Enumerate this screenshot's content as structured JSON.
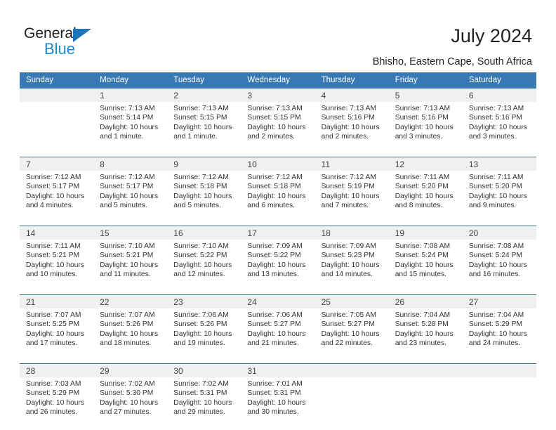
{
  "brand": {
    "name_part1": "General",
    "name_part2": "Blue",
    "color_dark": "#231f20",
    "color_blue": "#2286c9",
    "triangle_color": "#1b75bb"
  },
  "header": {
    "title": "July 2024",
    "subtitle": "Bhisho, Eastern Cape, South Africa"
  },
  "theme": {
    "header_bg": "#3878b4",
    "header_text": "#ffffff",
    "daynum_bg": "#f0f0f0",
    "cell_bg": "#ffffff",
    "separator": "#3878b4"
  },
  "calendar": {
    "weekday_headers": [
      "Sunday",
      "Monday",
      "Tuesday",
      "Wednesday",
      "Thursday",
      "Friday",
      "Saturday"
    ],
    "weeks": [
      {
        "days": [
          {
            "number": "",
            "sunrise": "",
            "sunset": "",
            "daylight_line1": "",
            "daylight_line2": ""
          },
          {
            "number": "1",
            "sunrise": "Sunrise: 7:13 AM",
            "sunset": "Sunset: 5:14 PM",
            "daylight_line1": "Daylight: 10 hours",
            "daylight_line2": "and 1 minute."
          },
          {
            "number": "2",
            "sunrise": "Sunrise: 7:13 AM",
            "sunset": "Sunset: 5:15 PM",
            "daylight_line1": "Daylight: 10 hours",
            "daylight_line2": "and 1 minute."
          },
          {
            "number": "3",
            "sunrise": "Sunrise: 7:13 AM",
            "sunset": "Sunset: 5:15 PM",
            "daylight_line1": "Daylight: 10 hours",
            "daylight_line2": "and 2 minutes."
          },
          {
            "number": "4",
            "sunrise": "Sunrise: 7:13 AM",
            "sunset": "Sunset: 5:16 PM",
            "daylight_line1": "Daylight: 10 hours",
            "daylight_line2": "and 2 minutes."
          },
          {
            "number": "5",
            "sunrise": "Sunrise: 7:13 AM",
            "sunset": "Sunset: 5:16 PM",
            "daylight_line1": "Daylight: 10 hours",
            "daylight_line2": "and 3 minutes."
          },
          {
            "number": "6",
            "sunrise": "Sunrise: 7:13 AM",
            "sunset": "Sunset: 5:16 PM",
            "daylight_line1": "Daylight: 10 hours",
            "daylight_line2": "and 3 minutes."
          }
        ]
      },
      {
        "days": [
          {
            "number": "7",
            "sunrise": "Sunrise: 7:12 AM",
            "sunset": "Sunset: 5:17 PM",
            "daylight_line1": "Daylight: 10 hours",
            "daylight_line2": "and 4 minutes."
          },
          {
            "number": "8",
            "sunrise": "Sunrise: 7:12 AM",
            "sunset": "Sunset: 5:17 PM",
            "daylight_line1": "Daylight: 10 hours",
            "daylight_line2": "and 5 minutes."
          },
          {
            "number": "9",
            "sunrise": "Sunrise: 7:12 AM",
            "sunset": "Sunset: 5:18 PM",
            "daylight_line1": "Daylight: 10 hours",
            "daylight_line2": "and 5 minutes."
          },
          {
            "number": "10",
            "sunrise": "Sunrise: 7:12 AM",
            "sunset": "Sunset: 5:18 PM",
            "daylight_line1": "Daylight: 10 hours",
            "daylight_line2": "and 6 minutes."
          },
          {
            "number": "11",
            "sunrise": "Sunrise: 7:12 AM",
            "sunset": "Sunset: 5:19 PM",
            "daylight_line1": "Daylight: 10 hours",
            "daylight_line2": "and 7 minutes."
          },
          {
            "number": "12",
            "sunrise": "Sunrise: 7:11 AM",
            "sunset": "Sunset: 5:20 PM",
            "daylight_line1": "Daylight: 10 hours",
            "daylight_line2": "and 8 minutes."
          },
          {
            "number": "13",
            "sunrise": "Sunrise: 7:11 AM",
            "sunset": "Sunset: 5:20 PM",
            "daylight_line1": "Daylight: 10 hours",
            "daylight_line2": "and 9 minutes."
          }
        ]
      },
      {
        "days": [
          {
            "number": "14",
            "sunrise": "Sunrise: 7:11 AM",
            "sunset": "Sunset: 5:21 PM",
            "daylight_line1": "Daylight: 10 hours",
            "daylight_line2": "and 10 minutes."
          },
          {
            "number": "15",
            "sunrise": "Sunrise: 7:10 AM",
            "sunset": "Sunset: 5:21 PM",
            "daylight_line1": "Daylight: 10 hours",
            "daylight_line2": "and 11 minutes."
          },
          {
            "number": "16",
            "sunrise": "Sunrise: 7:10 AM",
            "sunset": "Sunset: 5:22 PM",
            "daylight_line1": "Daylight: 10 hours",
            "daylight_line2": "and 12 minutes."
          },
          {
            "number": "17",
            "sunrise": "Sunrise: 7:09 AM",
            "sunset": "Sunset: 5:22 PM",
            "daylight_line1": "Daylight: 10 hours",
            "daylight_line2": "and 13 minutes."
          },
          {
            "number": "18",
            "sunrise": "Sunrise: 7:09 AM",
            "sunset": "Sunset: 5:23 PM",
            "daylight_line1": "Daylight: 10 hours",
            "daylight_line2": "and 14 minutes."
          },
          {
            "number": "19",
            "sunrise": "Sunrise: 7:08 AM",
            "sunset": "Sunset: 5:24 PM",
            "daylight_line1": "Daylight: 10 hours",
            "daylight_line2": "and 15 minutes."
          },
          {
            "number": "20",
            "sunrise": "Sunrise: 7:08 AM",
            "sunset": "Sunset: 5:24 PM",
            "daylight_line1": "Daylight: 10 hours",
            "daylight_line2": "and 16 minutes."
          }
        ]
      },
      {
        "days": [
          {
            "number": "21",
            "sunrise": "Sunrise: 7:07 AM",
            "sunset": "Sunset: 5:25 PM",
            "daylight_line1": "Daylight: 10 hours",
            "daylight_line2": "and 17 minutes."
          },
          {
            "number": "22",
            "sunrise": "Sunrise: 7:07 AM",
            "sunset": "Sunset: 5:26 PM",
            "daylight_line1": "Daylight: 10 hours",
            "daylight_line2": "and 18 minutes."
          },
          {
            "number": "23",
            "sunrise": "Sunrise: 7:06 AM",
            "sunset": "Sunset: 5:26 PM",
            "daylight_line1": "Daylight: 10 hours",
            "daylight_line2": "and 19 minutes."
          },
          {
            "number": "24",
            "sunrise": "Sunrise: 7:06 AM",
            "sunset": "Sunset: 5:27 PM",
            "daylight_line1": "Daylight: 10 hours",
            "daylight_line2": "and 21 minutes."
          },
          {
            "number": "25",
            "sunrise": "Sunrise: 7:05 AM",
            "sunset": "Sunset: 5:27 PM",
            "daylight_line1": "Daylight: 10 hours",
            "daylight_line2": "and 22 minutes."
          },
          {
            "number": "26",
            "sunrise": "Sunrise: 7:04 AM",
            "sunset": "Sunset: 5:28 PM",
            "daylight_line1": "Daylight: 10 hours",
            "daylight_line2": "and 23 minutes."
          },
          {
            "number": "27",
            "sunrise": "Sunrise: 7:04 AM",
            "sunset": "Sunset: 5:29 PM",
            "daylight_line1": "Daylight: 10 hours",
            "daylight_line2": "and 24 minutes."
          }
        ]
      },
      {
        "days": [
          {
            "number": "28",
            "sunrise": "Sunrise: 7:03 AM",
            "sunset": "Sunset: 5:29 PM",
            "daylight_line1": "Daylight: 10 hours",
            "daylight_line2": "and 26 minutes."
          },
          {
            "number": "29",
            "sunrise": "Sunrise: 7:02 AM",
            "sunset": "Sunset: 5:30 PM",
            "daylight_line1": "Daylight: 10 hours",
            "daylight_line2": "and 27 minutes."
          },
          {
            "number": "30",
            "sunrise": "Sunrise: 7:02 AM",
            "sunset": "Sunset: 5:31 PM",
            "daylight_line1": "Daylight: 10 hours",
            "daylight_line2": "and 29 minutes."
          },
          {
            "number": "31",
            "sunrise": "Sunrise: 7:01 AM",
            "sunset": "Sunset: 5:31 PM",
            "daylight_line1": "Daylight: 10 hours",
            "daylight_line2": "and 30 minutes."
          },
          {
            "number": "",
            "sunrise": "",
            "sunset": "",
            "daylight_line1": "",
            "daylight_line2": ""
          },
          {
            "number": "",
            "sunrise": "",
            "sunset": "",
            "daylight_line1": "",
            "daylight_line2": ""
          },
          {
            "number": "",
            "sunrise": "",
            "sunset": "",
            "daylight_line1": "",
            "daylight_line2": ""
          }
        ]
      }
    ]
  }
}
